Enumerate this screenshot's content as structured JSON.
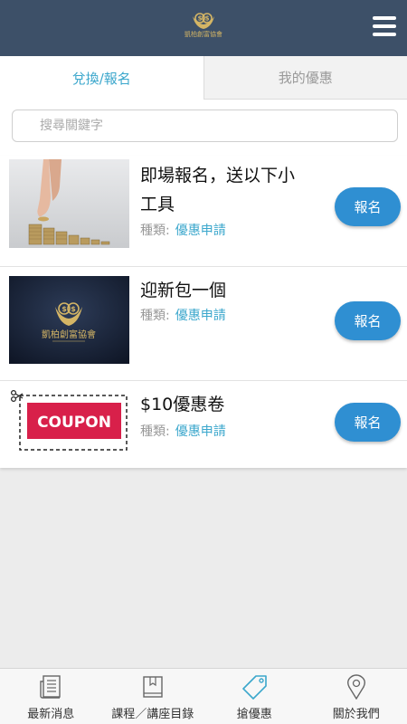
{
  "header": {
    "logo_text": "凱柏創富協會",
    "logo_color": "#d4b565",
    "bg_color": "#3d5068"
  },
  "tabs": [
    {
      "label": "兌換/報名",
      "active": true
    },
    {
      "label": "我的優惠",
      "active": false
    }
  ],
  "search": {
    "placeholder": "搜尋關鍵字",
    "value": ""
  },
  "items": [
    {
      "title": "即場報名，送以下小工具",
      "category_label": "種類:",
      "category": "優惠申請",
      "button": "報名",
      "thumb": "coins-photo"
    },
    {
      "title": "迎新包一個",
      "category_label": "種類:",
      "category": "優惠申請",
      "button": "報名",
      "thumb": "association-logo",
      "thumb_text": "凱柏創富協會"
    },
    {
      "title": "$10優惠卷",
      "category_label": "種類:",
      "category": "優惠申請",
      "button": "報名",
      "thumb": "coupon",
      "thumb_text": "COUPON"
    }
  ],
  "bottom_nav": [
    {
      "label": "最新消息",
      "icon": "newspaper-icon",
      "active": false
    },
    {
      "label": "課程／講座目錄",
      "icon": "book-icon",
      "active": false
    },
    {
      "label": "搶優惠",
      "icon": "tag-icon",
      "active": true
    },
    {
      "label": "關於我們",
      "icon": "location-pin-icon",
      "active": false
    }
  ],
  "colors": {
    "accent": "#3ba7cc",
    "button": "#2f8fd2",
    "coupon_red": "#d8204a"
  }
}
